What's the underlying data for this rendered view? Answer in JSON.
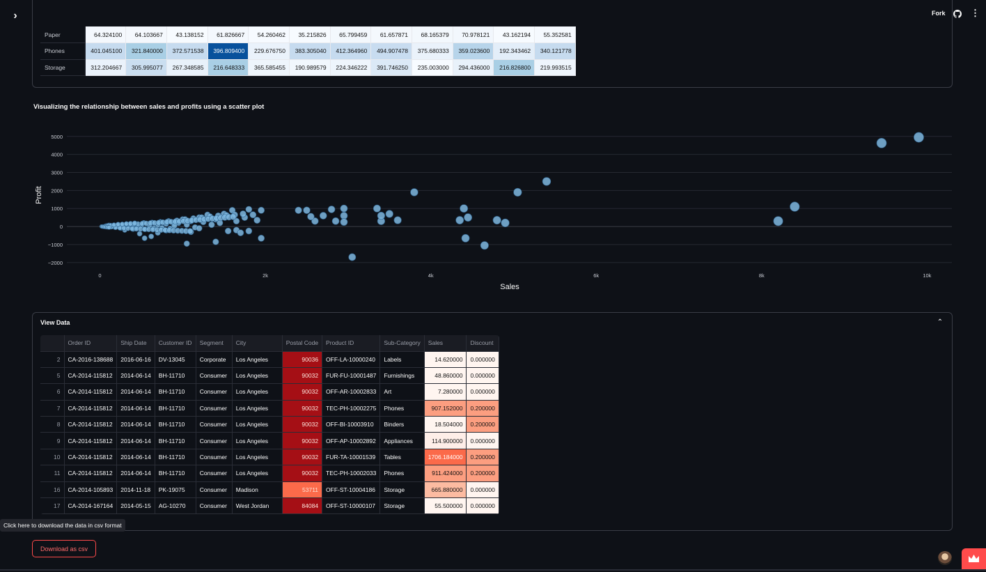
{
  "header": {
    "fork_label": "Fork",
    "icons": [
      "sidebar-expand-icon",
      "github-icon",
      "kebab-menu-icon"
    ]
  },
  "pivot_table": {
    "rows": [
      {
        "label": "Paper",
        "values": [
          "64.324100",
          "64.103667",
          "43.138152",
          "61.826667",
          "54.260462",
          "35.215826",
          "65.799459",
          "61.657871",
          "68.165379",
          "70.978121",
          "43.162194",
          "55.352581"
        ],
        "colors": [
          "#f4f8fd",
          "#f4f8fd",
          "#f7fbff",
          "#f4f8fd",
          "#f6faff",
          "#f7fbff",
          "#f3f8fd",
          "#f4f8fd",
          "#f3f8fd",
          "#f2f7fd",
          "#f7fbff",
          "#f5f9fe"
        ]
      },
      {
        "label": "Phones",
        "values": [
          "401.045100",
          "321.840000",
          "372.571538",
          "396.809400",
          "229.676750",
          "383.305040",
          "412.364960",
          "494.907478",
          "375.680333",
          "359.023600",
          "192.343462",
          "340.121778"
        ],
        "colors": [
          "#c6dbef",
          "#a9cfe5",
          "#c6dbef",
          "#08519c",
          "#eaf2fb",
          "#c6dbef",
          "#c6dbef",
          "#c8dcf0",
          "#eaf2fb",
          "#b7d4ea",
          "#e3eef9",
          "#c6dbef"
        ]
      },
      {
        "label": "Storage",
        "values": [
          "312.204667",
          "305.995077",
          "267.348585",
          "216.648333",
          "365.585455",
          "190.989579",
          "224.346222",
          "391.746250",
          "235.003000",
          "294.436000",
          "216.826800",
          "219.993515"
        ],
        "colors": [
          "#eaf2fb",
          "#cadef0",
          "#e8f1fa",
          "#a9cfe5",
          "#eef5fc",
          "#f1f7fd",
          "#eef5fc",
          "#dbe9f6",
          "#f7fbff",
          "#e8f1fa",
          "#a9cfe5",
          "#eef5fc"
        ]
      }
    ]
  },
  "scatter": {
    "title": "Visualizing the relationship between sales and profits using a scatter plot",
    "point_color": "#7fb8e0"
  },
  "chart_data": {
    "type": "scatter",
    "title": "Visualizing the relationship between sales and profits using a scatter plot",
    "xlabel": "Sales",
    "ylabel": "Profit",
    "xlim": [
      -400,
      10300
    ],
    "ylim": [
      -2200,
      5300
    ],
    "x_ticks": [
      0,
      2000,
      4000,
      6000,
      8000,
      10000
    ],
    "x_tick_labels": [
      "0",
      "2k",
      "4k",
      "6k",
      "8k",
      "10k"
    ],
    "y_ticks": [
      -2000,
      -1000,
      0,
      1000,
      2000,
      3000,
      4000,
      5000
    ],
    "y_tick_labels": [
      "−2000",
      "−1000",
      "0",
      "1000",
      "2000",
      "3000",
      "4000",
      "5000"
    ],
    "grid": "horizontal",
    "points": [
      [
        9900,
        4950
      ],
      [
        9450,
        4630
      ],
      [
        5400,
        2500
      ],
      [
        5050,
        1900
      ],
      [
        3800,
        1900
      ],
      [
        8400,
        1100
      ],
      [
        8200,
        300
      ],
      [
        4400,
        1000
      ],
      [
        4450,
        500
      ],
      [
        4800,
        350
      ],
      [
        4900,
        200
      ],
      [
        4350,
        350
      ],
      [
        4420,
        -650
      ],
      [
        4650,
        -1050
      ],
      [
        3050,
        -1700
      ],
      [
        3600,
        350
      ],
      [
        3400,
        300
      ],
      [
        3350,
        1000
      ],
      [
        3400,
        600
      ],
      [
        3500,
        700
      ],
      [
        2950,
        600
      ],
      [
        2850,
        300
      ],
      [
        2800,
        950
      ],
      [
        2950,
        1000
      ],
      [
        2600,
        300
      ],
      [
        2700,
        600
      ],
      [
        2500,
        900
      ],
      [
        2400,
        900
      ],
      [
        2550,
        550
      ],
      [
        2950,
        250
      ],
      [
        1850,
        650
      ],
      [
        1900,
        350
      ],
      [
        1950,
        900
      ],
      [
        1800,
        950
      ],
      [
        1600,
        900
      ],
      [
        1500,
        700
      ],
      [
        1750,
        500
      ],
      [
        1650,
        300
      ],
      [
        1800,
        -250
      ],
      [
        1950,
        -650
      ],
      [
        1650,
        -200
      ],
      [
        1400,
        -850
      ],
      [
        1050,
        -950
      ],
      [
        1700,
        -350
      ],
      [
        1550,
        -250
      ],
      [
        1300,
        650
      ],
      [
        1200,
        500
      ],
      [
        1400,
        400
      ],
      [
        1100,
        300
      ],
      [
        1000,
        400
      ],
      [
        1250,
        250
      ],
      [
        900,
        200
      ],
      [
        800,
        150
      ],
      [
        700,
        100
      ],
      [
        600,
        50
      ],
      [
        950,
        200
      ],
      [
        500,
        50
      ],
      [
        400,
        20
      ],
      [
        300,
        10
      ],
      [
        250,
        50
      ],
      [
        200,
        10
      ],
      [
        150,
        30
      ],
      [
        100,
        5
      ],
      [
        80,
        -20
      ],
      [
        60,
        10
      ],
      [
        40,
        5
      ],
      [
        20,
        2
      ],
      [
        120,
        -40
      ],
      [
        180,
        -50
      ],
      [
        350,
        30
      ],
      [
        450,
        -60
      ],
      [
        550,
        -150
      ],
      [
        650,
        -100
      ],
      [
        750,
        -80
      ],
      [
        850,
        -120
      ],
      [
        1150,
        -50
      ],
      [
        1350,
        100
      ],
      [
        1450,
        200
      ],
      [
        1050,
        100
      ],
      [
        900,
        50
      ],
      [
        620,
        -550
      ],
      [
        540,
        -650
      ],
      [
        480,
        -400
      ],
      [
        700,
        -350
      ],
      [
        800,
        -220
      ],
      [
        1100,
        -300
      ],
      [
        1200,
        -100
      ],
      [
        300,
        -200
      ],
      [
        400,
        -150
      ],
      [
        250,
        -100
      ],
      [
        330,
        120
      ],
      [
        430,
        150
      ],
      [
        530,
        200
      ],
      [
        630,
        220
      ],
      [
        730,
        250
      ],
      [
        830,
        300
      ],
      [
        930,
        330
      ],
      [
        1030,
        400
      ],
      [
        1130,
        450
      ],
      [
        1230,
        500
      ],
      [
        1330,
        550
      ],
      [
        1430,
        600
      ],
      [
        1530,
        620
      ],
      [
        1630,
        650
      ],
      [
        1730,
        700
      ],
      [
        160,
        60
      ],
      [
        210,
        80
      ],
      [
        260,
        90
      ],
      [
        310,
        100
      ],
      [
        360,
        110
      ],
      [
        410,
        130
      ],
      [
        460,
        140
      ],
      [
        510,
        160
      ],
      [
        560,
        170
      ],
      [
        610,
        190
      ],
      [
        660,
        200
      ],
      [
        710,
        210
      ],
      [
        760,
        230
      ],
      [
        810,
        250
      ],
      [
        860,
        260
      ],
      [
        910,
        270
      ],
      [
        960,
        280
      ],
      [
        1010,
        300
      ],
      [
        1060,
        320
      ],
      [
        1110,
        340
      ],
      [
        1160,
        360
      ],
      [
        1210,
        380
      ],
      [
        1260,
        400
      ],
      [
        1310,
        420
      ],
      [
        1360,
        440
      ],
      [
        1410,
        460
      ],
      [
        1460,
        480
      ],
      [
        1510,
        500
      ],
      [
        1560,
        520
      ],
      [
        1610,
        540
      ],
      [
        140,
        -30
      ],
      [
        190,
        -60
      ],
      [
        240,
        -80
      ],
      [
        290,
        -90
      ],
      [
        340,
        -110
      ],
      [
        390,
        -120
      ],
      [
        440,
        -130
      ],
      [
        490,
        -140
      ],
      [
        540,
        -150
      ],
      [
        590,
        -160
      ],
      [
        640,
        -170
      ],
      [
        690,
        -180
      ],
      [
        740,
        -190
      ],
      [
        790,
        -200
      ],
      [
        840,
        -210
      ],
      [
        890,
        -220
      ],
      [
        940,
        -230
      ],
      [
        990,
        -240
      ],
      [
        1040,
        -250
      ],
      [
        1090,
        -260
      ],
      [
        70,
        40
      ],
      [
        90,
        60
      ],
      [
        110,
        80
      ],
      [
        130,
        70
      ],
      [
        170,
        90
      ],
      [
        220,
        120
      ],
      [
        270,
        130
      ],
      [
        320,
        150
      ],
      [
        370,
        160
      ],
      [
        420,
        180
      ],
      [
        30,
        -10
      ],
      [
        50,
        -20
      ],
      [
        70,
        -30
      ],
      [
        90,
        -40
      ],
      [
        110,
        -50
      ]
    ]
  },
  "view_data": {
    "title": "View Data",
    "columns": [
      "",
      "Order ID",
      "Ship Date",
      "Customer ID",
      "Segment",
      "City",
      "Postal Code",
      "Product ID",
      "Sub-Category",
      "Sales",
      "Discount"
    ],
    "rows": [
      [
        "2",
        "CA-2016-138688",
        "2016-06-16",
        "DV-13045",
        "Corporate",
        "Los Angeles",
        "90036",
        "OFF-LA-10000240",
        "Labels",
        "14.620000",
        "0.000000"
      ],
      [
        "5",
        "CA-2014-115812",
        "2014-06-14",
        "BH-11710",
        "Consumer",
        "Los Angeles",
        "90032",
        "FUR-FU-10001487",
        "Furnishings",
        "48.860000",
        "0.000000"
      ],
      [
        "6",
        "CA-2014-115812",
        "2014-06-14",
        "BH-11710",
        "Consumer",
        "Los Angeles",
        "90032",
        "OFF-AR-10002833",
        "Art",
        "7.280000",
        "0.000000"
      ],
      [
        "7",
        "CA-2014-115812",
        "2014-06-14",
        "BH-11710",
        "Consumer",
        "Los Angeles",
        "90032",
        "TEC-PH-10002275",
        "Phones",
        "907.152000",
        "0.200000"
      ],
      [
        "8",
        "CA-2014-115812",
        "2014-06-14",
        "BH-11710",
        "Consumer",
        "Los Angeles",
        "90032",
        "OFF-BI-10003910",
        "Binders",
        "18.504000",
        "0.200000"
      ],
      [
        "9",
        "CA-2014-115812",
        "2014-06-14",
        "BH-11710",
        "Consumer",
        "Los Angeles",
        "90032",
        "OFF-AP-10002892",
        "Appliances",
        "114.900000",
        "0.000000"
      ],
      [
        "10",
        "CA-2014-115812",
        "2014-06-14",
        "BH-11710",
        "Consumer",
        "Los Angeles",
        "90032",
        "FUR-TA-10001539",
        "Tables",
        "1706.184000",
        "0.200000"
      ],
      [
        "11",
        "CA-2014-115812",
        "2014-06-14",
        "BH-11710",
        "Consumer",
        "Los Angeles",
        "90032",
        "TEC-PH-10002033",
        "Phones",
        "911.424000",
        "0.200000"
      ],
      [
        "16",
        "CA-2014-105893",
        "2014-11-18",
        "PK-19075",
        "Consumer",
        "Madison",
        "53711",
        "OFF-ST-10004186",
        "Storage",
        "665.880000",
        "0.000000"
      ],
      [
        "17",
        "CA-2014-167164",
        "2014-05-15",
        "AG-10270",
        "Consumer",
        "West Jordan",
        "84084",
        "OFF-ST-10000107",
        "Storage",
        "55.500000",
        "0.000000"
      ]
    ],
    "postal_colors": [
      "#a50f15",
      "#a50f15",
      "#a50f15",
      "#a50f15",
      "#a50f15",
      "#a50f15",
      "#a50f15",
      "#a50f15",
      "#fb6a4a",
      "#a50f15"
    ],
    "sales_colors": [
      "#fff5f0",
      "#fff5f0",
      "#fff5f0",
      "#fc9e80",
      "#fff5f0",
      "#feeee8",
      "#fb6a4a",
      "#fc9e80",
      "#fcbba1",
      "#fff5f0"
    ],
    "discount_colors": [
      "#fff5f0",
      "#fff5f0",
      "#fff5f0",
      "#fc9e80",
      "#fc9e80",
      "#fff5f0",
      "#fc9e80",
      "#fc9e80",
      "#fff5f0",
      "#fff5f0"
    ]
  },
  "tooltip": {
    "text": "Click here to download the data in csv format"
  },
  "download": {
    "label": "Download as csv"
  }
}
